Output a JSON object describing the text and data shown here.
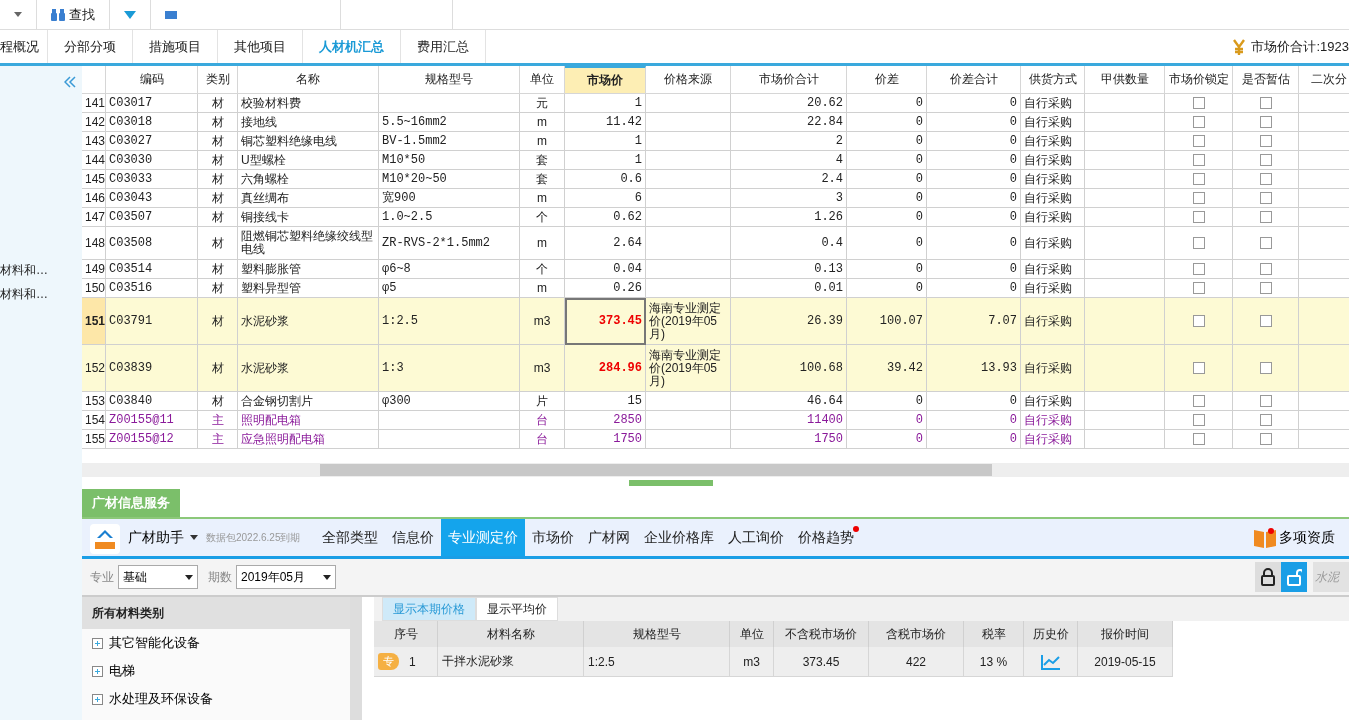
{
  "toolbar": {
    "items": [
      {
        "label": "查找"
      }
    ]
  },
  "tabs": [
    {
      "label": "程概况",
      "selected": false
    },
    {
      "label": "分部分项",
      "selected": false
    },
    {
      "label": "措施项目",
      "selected": false
    },
    {
      "label": "其他项目",
      "selected": false
    },
    {
      "label": "人材机汇总",
      "selected": true
    },
    {
      "label": "费用汇总",
      "selected": false
    }
  ],
  "market_total": {
    "label": "市场价合计:1923"
  },
  "side_panel": {
    "items": [
      "材料和…",
      "材料和…"
    ]
  },
  "grid": {
    "columns": [
      "",
      "编码",
      "类别",
      "名称",
      "规格型号",
      "单位",
      "市场价",
      "价格来源",
      "市场价合计",
      "价差",
      "价差合计",
      "供货方式",
      "甲供数量",
      "市场价锁定",
      "是否暂估",
      "二次分"
    ],
    "rows": [
      {
        "kind": "material",
        "no": "141",
        "code": "C03017",
        "type": "材",
        "name": "校验材料费",
        "spec": "",
        "unit": "元",
        "price": "1",
        "source": "",
        "total": "20.62",
        "diff": "0",
        "diff_total": "0",
        "supply": "自行采购",
        "price_locked": false,
        "provisional": false,
        "highlighted": false,
        "selected": false
      },
      {
        "kind": "material",
        "no": "142",
        "code": "C03018",
        "type": "材",
        "name": "接地线",
        "spec": "5.5~16mm2",
        "unit": "m",
        "price": "11.42",
        "source": "",
        "total": "22.84",
        "diff": "0",
        "diff_total": "0",
        "supply": "自行采购",
        "price_locked": false,
        "provisional": false,
        "highlighted": false,
        "selected": false
      },
      {
        "kind": "material",
        "no": "143",
        "code": "C03027",
        "type": "材",
        "name": "铜芯塑料绝缘电线",
        "spec": "BV-1.5mm2",
        "unit": "m",
        "price": "1",
        "source": "",
        "total": "2",
        "diff": "0",
        "diff_total": "0",
        "supply": "自行采购",
        "price_locked": false,
        "provisional": false,
        "highlighted": false,
        "selected": false
      },
      {
        "kind": "material",
        "no": "144",
        "code": "C03030",
        "type": "材",
        "name": "U型螺栓",
        "spec": "M10*50",
        "unit": "套",
        "price": "1",
        "source": "",
        "total": "4",
        "diff": "0",
        "diff_total": "0",
        "supply": "自行采购",
        "price_locked": false,
        "provisional": false,
        "highlighted": false,
        "selected": false
      },
      {
        "kind": "material",
        "no": "145",
        "code": "C03033",
        "type": "材",
        "name": "六角螺栓",
        "spec": "M10*20~50",
        "unit": "套",
        "price": "0.6",
        "source": "",
        "total": "2.4",
        "diff": "0",
        "diff_total": "0",
        "supply": "自行采购",
        "price_locked": false,
        "provisional": false,
        "highlighted": false,
        "selected": false
      },
      {
        "kind": "material",
        "no": "146",
        "code": "C03043",
        "type": "材",
        "name": "真丝绸布",
        "spec": "宽900",
        "unit": "m",
        "price": "6",
        "source": "",
        "total": "3",
        "diff": "0",
        "diff_total": "0",
        "supply": "自行采购",
        "price_locked": false,
        "provisional": false,
        "highlighted": false,
        "selected": false
      },
      {
        "kind": "material",
        "no": "147",
        "code": "C03507",
        "type": "材",
        "name": "铜接线卡",
        "spec": "1.0~2.5",
        "unit": "个",
        "price": "0.62",
        "source": "",
        "total": "1.26",
        "diff": "0",
        "diff_total": "0",
        "supply": "自行采购",
        "price_locked": false,
        "provisional": false,
        "highlighted": false,
        "selected": false
      },
      {
        "kind": "material",
        "no": "148",
        "code": "C03508",
        "type": "材",
        "name": "阻燃铜芯塑料绝缘绞线型电线",
        "spec": "ZR-RVS-2*1.5mm2",
        "unit": "m",
        "price": "2.64",
        "source": "",
        "total": "0.4",
        "diff": "0",
        "diff_total": "0",
        "supply": "自行采购",
        "price_locked": false,
        "provisional": false,
        "highlighted": false,
        "selected": false
      },
      {
        "kind": "material",
        "no": "149",
        "code": "C03514",
        "type": "材",
        "name": "塑料膨胀管",
        "spec": "φ6~8",
        "unit": "个",
        "price": "0.04",
        "source": "",
        "total": "0.13",
        "diff": "0",
        "diff_total": "0",
        "supply": "自行采购",
        "price_locked": false,
        "provisional": false,
        "highlighted": false,
        "selected": false
      },
      {
        "kind": "material",
        "no": "150",
        "code": "C03516",
        "type": "材",
        "name": "塑料异型管",
        "spec": "φ5",
        "unit": "m",
        "price": "0.26",
        "source": "",
        "total": "0.01",
        "diff": "0",
        "diff_total": "0",
        "supply": "自行采购",
        "price_locked": false,
        "provisional": false,
        "highlighted": false,
        "selected": false
      },
      {
        "kind": "material",
        "no": "151",
        "code": "C03791",
        "type": "材",
        "name": "水泥砂浆",
        "spec": "1:2.5",
        "unit": "m3",
        "price": "373.45",
        "source": "海南专业测定价(2019年05月)",
        "total": "26.39",
        "diff": "100.07",
        "diff_total": "7.07",
        "supply": "自行采购",
        "price_locked": false,
        "provisional": false,
        "highlighted": true,
        "selected": true
      },
      {
        "kind": "material",
        "no": "152",
        "code": "C03839",
        "type": "材",
        "name": "水泥砂浆",
        "spec": "1:3",
        "unit": "m3",
        "price": "284.96",
        "source": "海南专业测定价(2019年05月)",
        "total": "100.68",
        "diff": "39.42",
        "diff_total": "13.93",
        "supply": "自行采购",
        "price_locked": false,
        "provisional": false,
        "highlighted": true,
        "selected": false
      },
      {
        "kind": "material",
        "no": "153",
        "code": "C03840",
        "type": "材",
        "name": "合金钢切割片",
        "spec": "φ300",
        "unit": "片",
        "price": "15",
        "source": "",
        "total": "46.64",
        "diff": "0",
        "diff_total": "0",
        "supply": "自行采购",
        "price_locked": false,
        "provisional": false,
        "highlighted": false,
        "selected": false
      },
      {
        "kind": "main",
        "no": "154",
        "code": "Z00155@11",
        "type": "主",
        "name": "照明配电箱",
        "spec": "",
        "unit": "台",
        "price": "2850",
        "source": "",
        "total": "11400",
        "diff": "0",
        "diff_total": "0",
        "supply": "自行采购",
        "price_locked": false,
        "provisional": false,
        "highlighted": false,
        "selected": false
      },
      {
        "kind": "main",
        "no": "155",
        "code": "Z00155@12",
        "type": "主",
        "name": "应急照明配电箱",
        "spec": "",
        "unit": "台",
        "price": "1750",
        "source": "",
        "total": "1750",
        "diff": "0",
        "diff_total": "0",
        "supply": "自行采购",
        "price_locked": false,
        "provisional": false,
        "highlighted": false,
        "selected": false
      }
    ]
  },
  "service_tab": {
    "label": "广材信息服务"
  },
  "assistant": {
    "title": "广材助手",
    "expiry": "数据包2022.6.25到期",
    "tabs": [
      {
        "label": "全部类型",
        "selected": false,
        "dot": false
      },
      {
        "label": "信息价",
        "selected": false,
        "dot": false
      },
      {
        "label": "专业测定价",
        "selected": true,
        "dot": false
      },
      {
        "label": "市场价",
        "selected": false,
        "dot": false
      },
      {
        "label": "广材网",
        "selected": false,
        "dot": false
      },
      {
        "label": "企业价格库",
        "selected": false,
        "dot": false
      },
      {
        "label": "人工询价",
        "selected": false,
        "dot": false
      },
      {
        "label": "价格趋势",
        "selected": false,
        "dot": true
      }
    ],
    "qualification": "多项资质"
  },
  "filters": {
    "major_label": "专业",
    "major": "基础",
    "period_label": "期数",
    "period": "2019年05月",
    "search_placeholder": "水泥"
  },
  "categories": {
    "title": "所有材料类别",
    "items": [
      {
        "label": "其它智能化设备",
        "expanded": false
      },
      {
        "label": "电梯",
        "expanded": false
      },
      {
        "label": "水处理及环保设备",
        "expanded": false
      }
    ]
  },
  "price_tabs": [
    {
      "label": "显示本期价格",
      "selected": true
    },
    {
      "label": "显示平均价",
      "selected": false
    }
  ],
  "price_table": {
    "columns": [
      "序号",
      "材料名称",
      "规格型号",
      "单位",
      "不含税市场价",
      "含税市场价",
      "税率",
      "历史价",
      "报价时间"
    ],
    "rows": [
      {
        "badge": "专",
        "no": "1",
        "name": "干拌水泥砂浆",
        "spec": "1:2.5",
        "unit": "m3",
        "price_ex_tax": "373.45",
        "price_inc_tax": "422",
        "tax_rate": "13 %",
        "date": "2019-05-15"
      }
    ]
  }
}
